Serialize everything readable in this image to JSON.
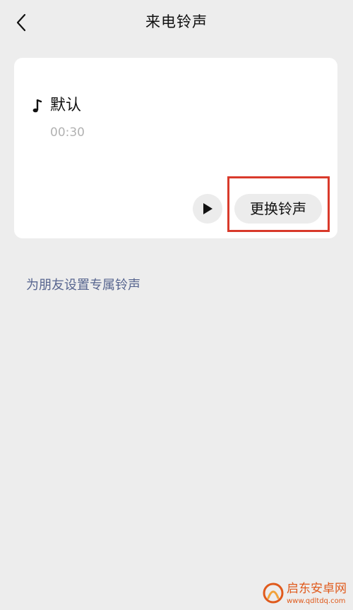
{
  "nav": {
    "title": "来电铃声",
    "back_icon": "chevron-left-icon"
  },
  "ringtone": {
    "name": "默认",
    "duration": "00:30",
    "note_icon": "music-note-icon",
    "play_icon": "play-icon",
    "change_label": "更换铃声",
    "highlight_color": "#d93a2b"
  },
  "friend_link": {
    "label": "为朋友设置专属铃声",
    "color": "#57658f"
  },
  "watermark": {
    "name": "启东安卓网",
    "url": "www.qdltdq.com",
    "color": "#e05a1c"
  }
}
